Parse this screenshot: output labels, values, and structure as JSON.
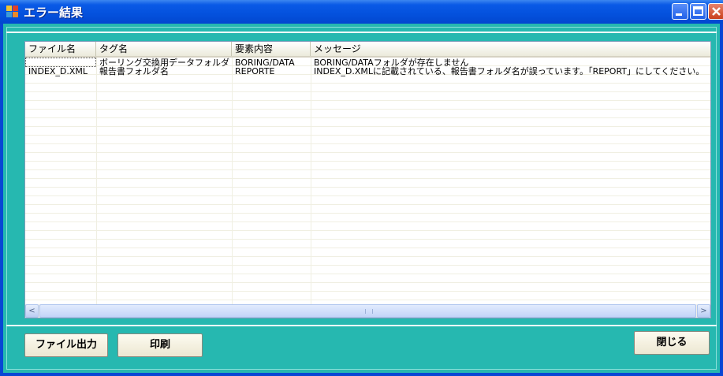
{
  "window": {
    "title": "エラー結果",
    "colors": {
      "titlebar": "#0451dd",
      "frame": "#26b8b0"
    }
  },
  "grid": {
    "columns": [
      "ファイル名",
      "タグ名",
      "要素内容",
      "メッセージ"
    ],
    "rows": [
      [
        "",
        "ボーリング交換用データフォルダ",
        "BORING/DATA",
        "BORING/DATAフォルダが存在しません"
      ],
      [
        "INDEX_D.XML",
        "報告書フォルダ名",
        "REPORTE",
        "INDEX_D.XMLに記載されている、報告書フォルダ名が誤っています。「REPORT」にしてください。"
      ]
    ],
    "scrollbar": {
      "left_arrow": "<",
      "right_arrow": ">"
    }
  },
  "buttons": {
    "file_output": "ファイル出力",
    "print": "印刷",
    "close": "閉じる"
  }
}
